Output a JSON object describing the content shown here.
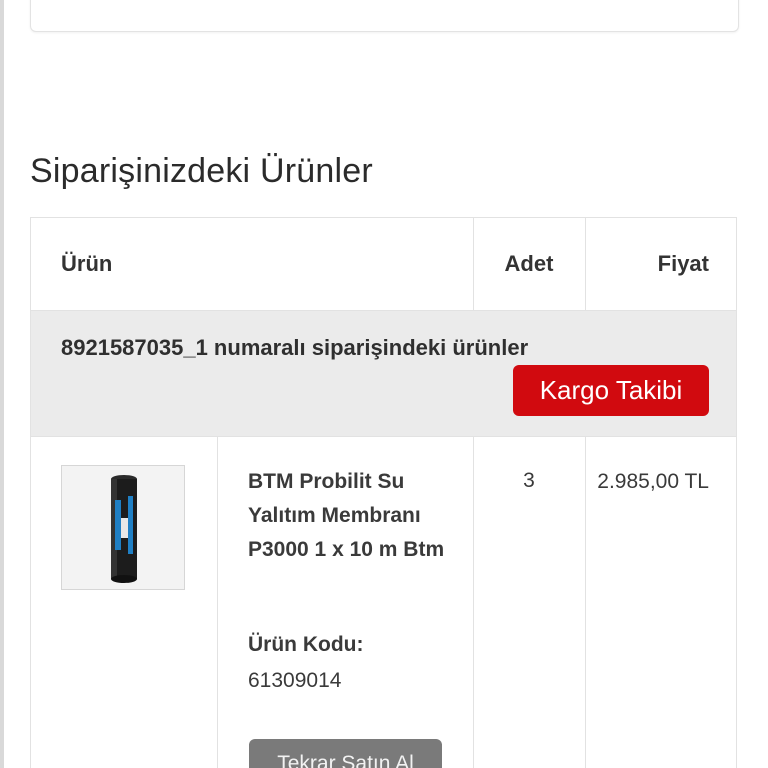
{
  "section": {
    "title": "Siparişinizdeki Ürünler"
  },
  "table": {
    "headers": {
      "product": "Ürün",
      "quantity": "Adet",
      "price": "Fiyat"
    },
    "order": {
      "label": "8921587035_1 numaralı siparişindeki ürünler",
      "tracking_button": "Kargo Takibi"
    },
    "item": {
      "name": "BTM Probilit Su Yalıtım Membranı P3000 1 x 10 m Btm",
      "code_label": "Ürün Kodu:",
      "code_value": "61309014",
      "quantity": "3",
      "price": "2.985,00 TL",
      "rebuy_button": "Tekrar Satın Al",
      "image_icon": "membrane-roll-image"
    }
  },
  "colors": {
    "accent_red": "#d10a0f",
    "order_row_bg": "#ebebeb",
    "rebuy_button_bg": "#7a7a7a"
  }
}
